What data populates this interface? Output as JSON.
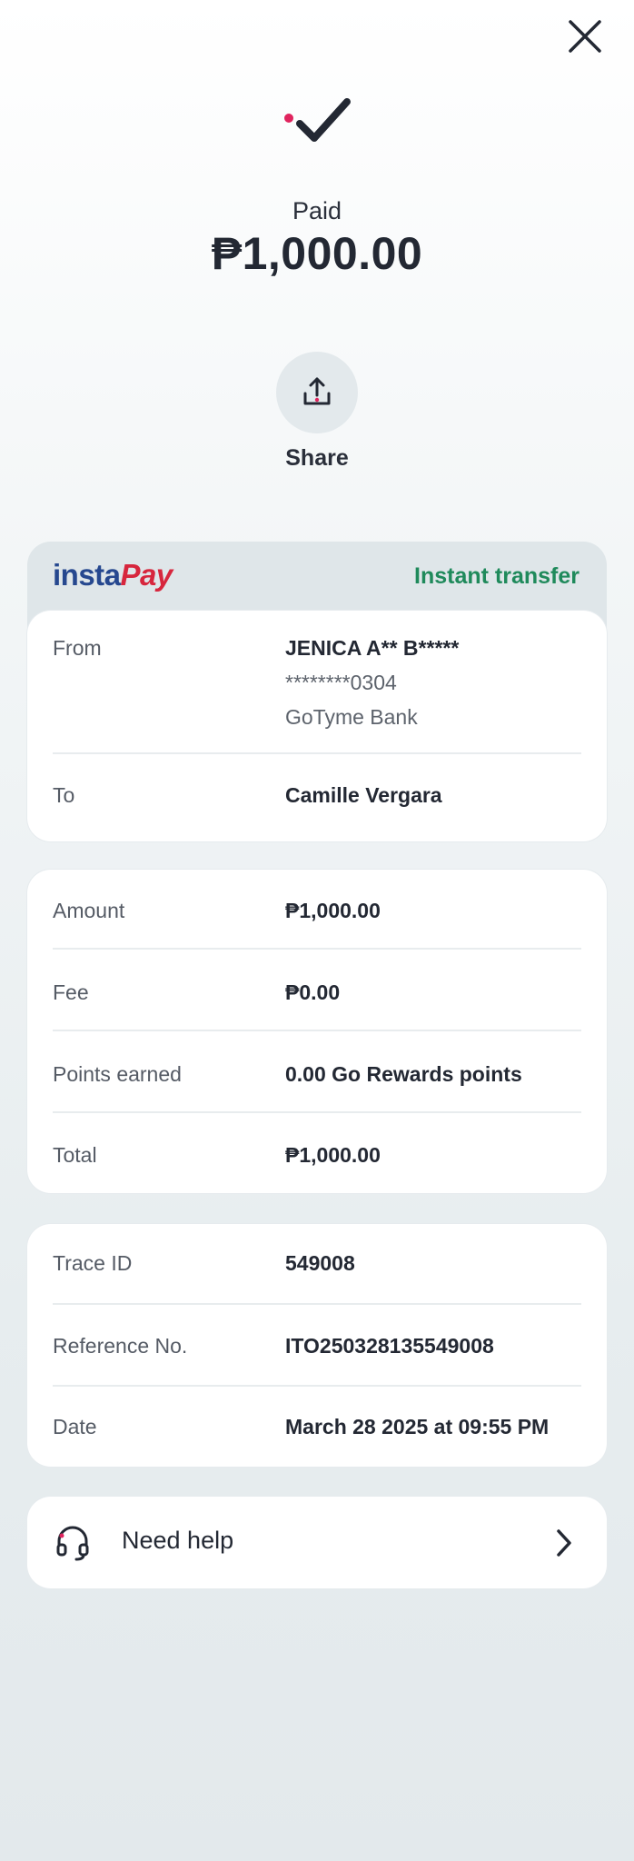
{
  "status": {
    "label": "Paid",
    "amount": "₱1,000.00"
  },
  "share": {
    "label": "Share"
  },
  "transfer": {
    "logo_insta": "insta",
    "logo_pay": "Pay",
    "type": "Instant transfer",
    "from_label": "From",
    "from_name": "JENICA A** B*****",
    "from_account": "********0304",
    "from_bank": "GoTyme Bank",
    "to_label": "To",
    "to_name": "Camille Vergara"
  },
  "amounts": {
    "amount_label": "Amount",
    "amount_value": "₱1,000.00",
    "fee_label": "Fee",
    "fee_value": "₱0.00",
    "points_label": "Points earned",
    "points_value": "0.00 Go Rewards points",
    "total_label": "Total",
    "total_value": "₱1,000.00"
  },
  "details": {
    "trace_label": "Trace ID",
    "trace_value": "549008",
    "reference_label": "Reference No.",
    "reference_value": "ITO250328135549008",
    "date_label": "Date",
    "date_value": "March 28 2025 at 09:55 PM"
  },
  "help": {
    "label": "Need help"
  },
  "colors": {
    "accent_dot": "#e0245e",
    "instant_transfer": "#1f8a5b",
    "insta_blue": "#26488f",
    "pay_red": "#d7263d"
  },
  "icons": [
    "close-icon",
    "checkmark-icon",
    "share-upload-icon",
    "headset-icon",
    "chevron-right-icon"
  ]
}
